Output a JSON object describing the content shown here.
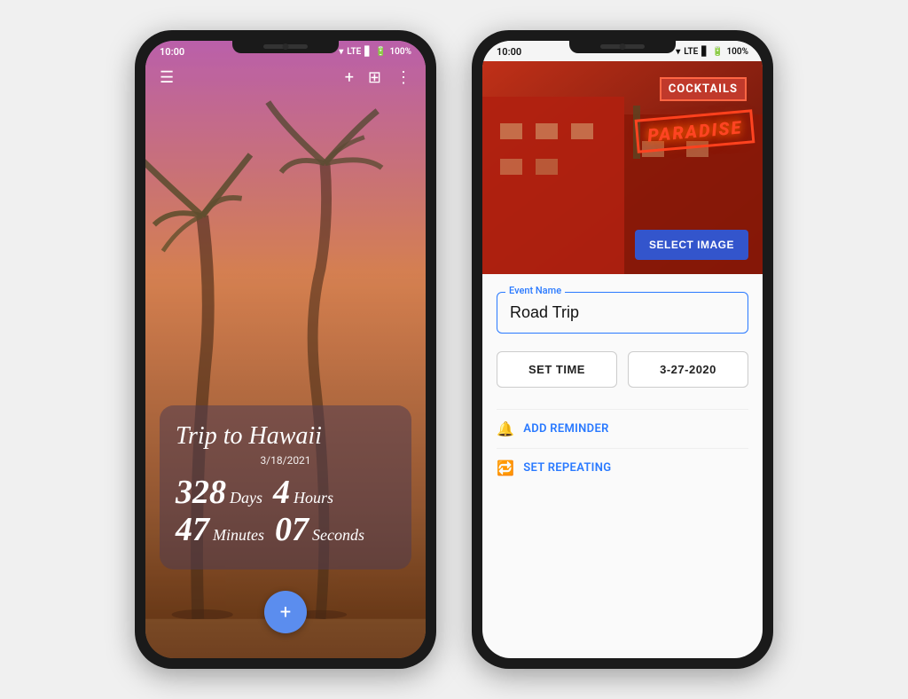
{
  "phone1": {
    "status": {
      "time": "10:00",
      "network": "LTE",
      "battery": "100%"
    },
    "toolbar": {
      "menu_icon": "☰",
      "add_icon": "+",
      "grid_icon": "⊞",
      "more_icon": "⋮"
    },
    "countdown": {
      "title": "Trip to Hawaii",
      "date": "3/18/2021",
      "days_num": "328",
      "days_label": "Days",
      "hours_num": "4",
      "hours_label": "Hours",
      "minutes_num": "47",
      "minutes_label": "Minutes",
      "seconds_num": "07",
      "seconds_label": "Seconds"
    },
    "fab_icon": "+"
  },
  "phone2": {
    "status": {
      "time": "10:00",
      "network": "LTE",
      "battery": "100%"
    },
    "hero": {
      "sign1": "COCKTAILS",
      "sign2": "PARADISE"
    },
    "select_image_btn": "SELECT IMAGE",
    "form": {
      "event_name_label": "Event Name",
      "event_name_value": "Road Trip",
      "set_time_label": "SET TIME",
      "date_value": "3-27-2020",
      "add_reminder_label": "ADD REMINDER",
      "set_repeating_label": "SET REPEATING"
    }
  }
}
